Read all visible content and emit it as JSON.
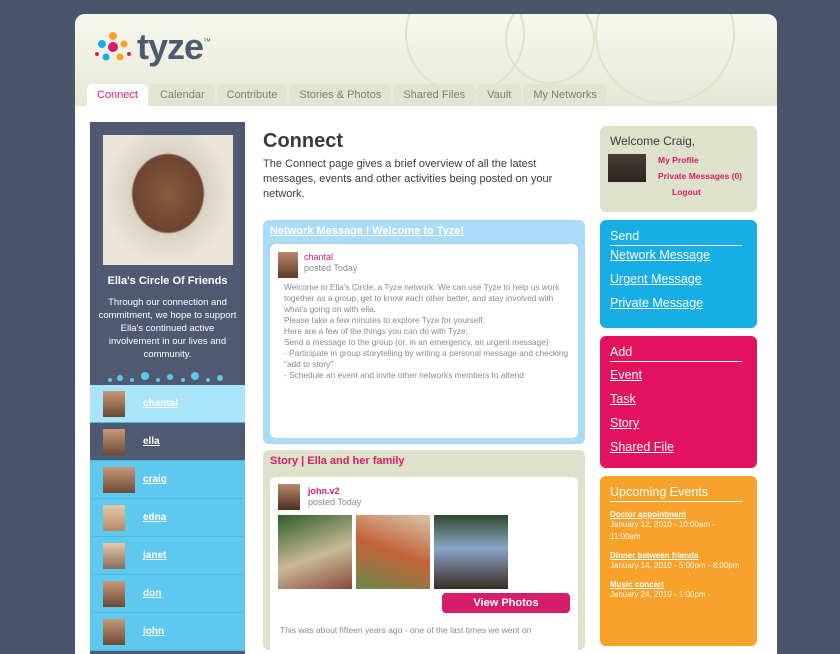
{
  "app": {
    "logo_text": "tyze",
    "logo_tm": "™"
  },
  "tabs": [
    {
      "label": "Connect",
      "active": true
    },
    {
      "label": "Calendar"
    },
    {
      "label": "Contribute"
    },
    {
      "label": "Stories & Photos"
    },
    {
      "label": "Shared Files"
    },
    {
      "label": "Vault"
    },
    {
      "label": "My Networks"
    }
  ],
  "left": {
    "circle_title": "Ella's Circle Of Friends",
    "circle_desc": "Through our connection and commitment, we hope to support Ella's continued active involvement in our lives and community.",
    "members": [
      {
        "name": "chantal"
      },
      {
        "name": "ella"
      },
      {
        "name": "craig"
      },
      {
        "name": "edna"
      },
      {
        "name": "janet"
      },
      {
        "name": "don"
      },
      {
        "name": "john"
      }
    ]
  },
  "main": {
    "title": "Connect",
    "intro": "The Connect page gives a brief overview of all the latest messages, events and other activities being posted on your network.",
    "network_message": {
      "heading": "Network Message | Welcome to Tyze!",
      "author": "chantal",
      "time": "posted Today",
      "body": "Welcome to Ella's Circle, a Tyze network. We can use Tyze to help us work together as a group, get to know each other better, and stay involved with what's going on with ella.\nPlease take a few minutes to explore Tyze for yourself.\nHere are a few of the things you can do with Tyze:\nSend a message to the group (or, in an emergency, an urgent message)\n- Participate in group storytelling by writing a personal message and checking \"add to story\"\n- Schedule an event and invite other networks members to attend"
    },
    "story": {
      "heading": "Story | Ella and her family",
      "author": "john.v2",
      "time": "posted Today",
      "view_button": "View Photos",
      "text": "This was about fifteen years ago - one of the last times we went on"
    }
  },
  "right": {
    "welcome": {
      "title": "Welcome Craig,",
      "links": [
        "My Profile",
        "Private Messages (0)",
        "Logout"
      ]
    },
    "send": {
      "title": "Send",
      "items": [
        "Network Message",
        "Urgent Message",
        "Private Message"
      ]
    },
    "add": {
      "title": "Add",
      "items": [
        "Event",
        "Task",
        "Story",
        "Shared File"
      ]
    },
    "events": {
      "title": "Upcoming Events",
      "items": [
        {
          "title": "Doctor appointment",
          "date": "January 12, 2010 - 10:00am - 11:00am"
        },
        {
          "title": "Dinner between friends",
          "date": "January 14, 2010 - 5:00pm - 8:00pm"
        },
        {
          "title": "Music concert",
          "date": "January 24, 2010 - 1:00pm -"
        }
      ]
    }
  },
  "colors": {
    "pink": "#d61d6a",
    "blue": "#17aee6",
    "orange": "#f7a22a",
    "navy": "#4f5a72"
  }
}
